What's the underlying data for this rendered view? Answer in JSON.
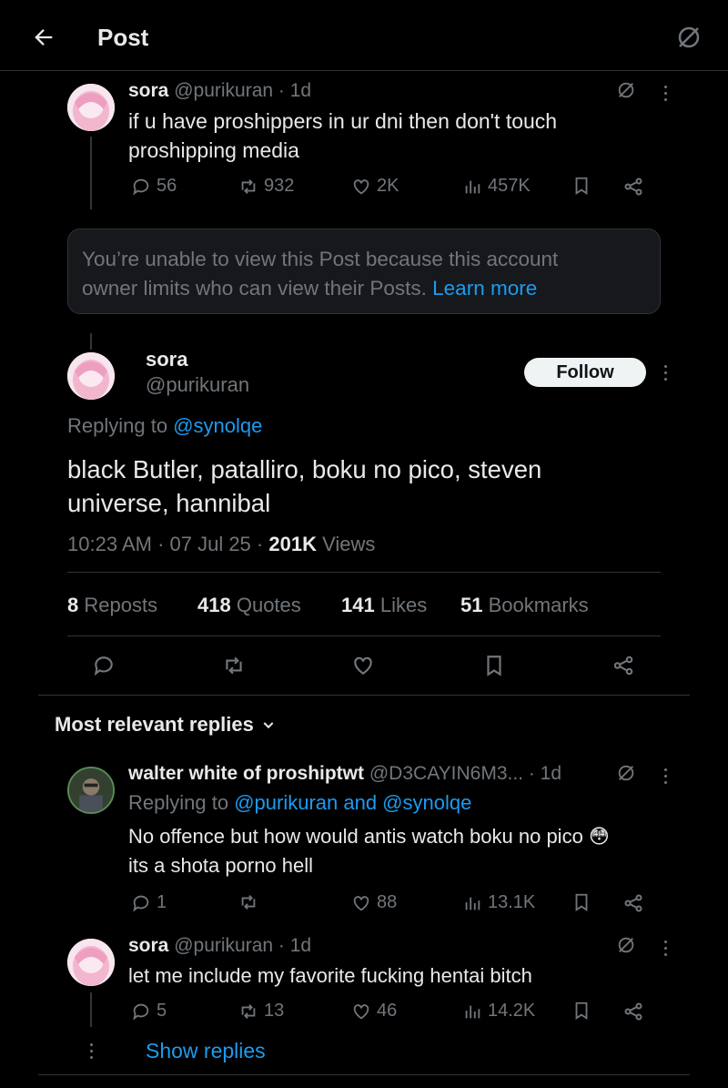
{
  "header": {
    "title": "Post"
  },
  "parent_post": {
    "name": "sora",
    "handle": "@purikuran",
    "time": "· 1d",
    "text_line1": "if u have proshippers in ur dni then don't touch",
    "text_line2": "proshipping media",
    "replies": "56",
    "reposts": "932",
    "likes": "2K",
    "views": "457K"
  },
  "notice": {
    "text_line1": "You’re unable to view this Post because this account",
    "text_line2": "owner limits who can view their Posts.",
    "link": "Learn more"
  },
  "main_post": {
    "name": "sora",
    "handle": "@purikuran",
    "follow_label": "Follow",
    "replying_prefix": "Replying to",
    "replying_to": "@synolqe",
    "text_line1": "black Butler, patalliro, boku no pico, steven",
    "text_line2": "universe, hannibal",
    "timestamp": "10:23 AM · 07 Jul 25 ·",
    "views_count": "201K",
    "views_label": "Views",
    "stats": [
      {
        "count": "8",
        "label": "Reposts"
      },
      {
        "count": "418",
        "label": "Quotes"
      },
      {
        "count": "141",
        "label": "Likes"
      },
      {
        "count": "51",
        "label": "Bookmarks"
      }
    ]
  },
  "replies_header": {
    "label": "Most relevant replies"
  },
  "reply1": {
    "name": "walter white of proshiptwt",
    "handle": "@D3CAYIN6M3...",
    "time": "· 1d",
    "replying_prefix": "Replying to",
    "replying_to": "@purikuran and @synolqe",
    "text_line1": "No offence but how would antis watch boku no pico 😳",
    "text_line2": "its a shota porno hell",
    "replies": "1",
    "reposts": "",
    "likes": "88",
    "views": "13.1K"
  },
  "reply2": {
    "name": "sora",
    "handle": "@purikuran",
    "time": "· 1d",
    "text_line1": "let me include my favorite fucking hentai bitch",
    "replies": "5",
    "reposts": "13",
    "likes": "46",
    "views": "14.2K",
    "show_replies": "Show replies"
  },
  "icons": [
    "back-arrow-icon",
    "grok-icon",
    "reply-icon",
    "repost-icon",
    "like-icon",
    "views-icon",
    "bookmark-icon",
    "share-icon",
    "more-icon",
    "chevron-down-icon"
  ],
  "colors": {
    "background": "#000000",
    "text": "#e7e9ea",
    "muted": "#71767b",
    "link": "#1d9bf0",
    "border": "#2f3336"
  }
}
